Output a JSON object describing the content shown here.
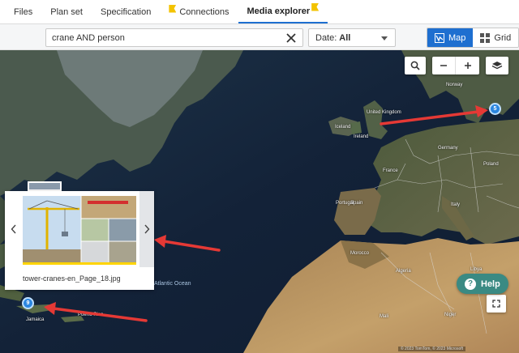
{
  "tabs": [
    {
      "label": "Files",
      "active": false,
      "flag": false
    },
    {
      "label": "Plan set",
      "active": false,
      "flag": false
    },
    {
      "label": "Specification",
      "active": false,
      "flag": false
    },
    {
      "label": "Connections",
      "active": false,
      "flag": true
    },
    {
      "label": "Media explorer",
      "active": true,
      "flag": true
    }
  ],
  "toolbar": {
    "search_value": "crane AND person",
    "date_label": "Date:",
    "date_value": "All",
    "map_label": "Map",
    "grid_label": "Grid",
    "active_view": "Map"
  },
  "map": {
    "labels": {
      "iceland": "Iceland",
      "united_kingdom": "United Kingdom",
      "ireland": "Ireland",
      "france": "France",
      "spain": "Spain",
      "portugal": "Portugal",
      "poland": "Poland",
      "germany": "Germany",
      "italy": "Italy",
      "norway": "Norway",
      "morocco": "Morocco",
      "algeria": "Algeria",
      "libya": "Libya",
      "niger": "Niger",
      "mali": "Mali",
      "atlantic_ocean": "Atlantic Ocean",
      "jamaica": "Jamaica",
      "puerto_rico": "Puerto Rico"
    },
    "clusters": [
      {
        "count": "5",
        "place": "Europe"
      },
      {
        "count": "9",
        "place": "Caribbean"
      }
    ],
    "attribution": "© 2023 TomTom, © 2023 Microsoft"
  },
  "preview": {
    "filename": "tower-cranes-en_Page_18.jpg"
  },
  "help": {
    "label": "Help"
  },
  "colors": {
    "accent": "#1e6fd0",
    "cluster": "#2b86e0",
    "help": "#3a8a83",
    "arrow": "#e53935",
    "flag": "#f3c300"
  }
}
